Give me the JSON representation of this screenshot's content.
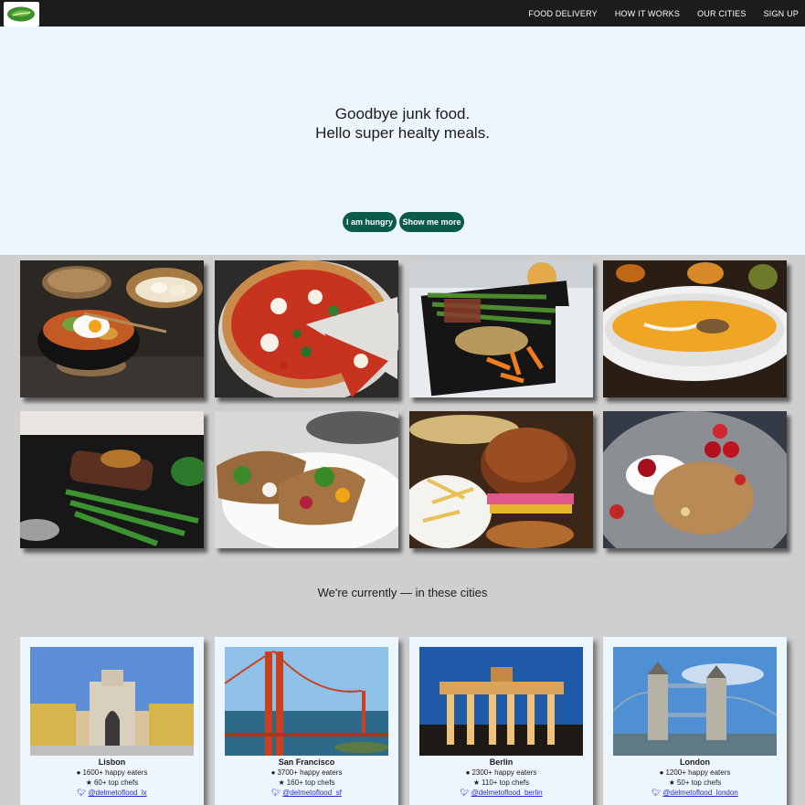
{
  "nav": {
    "logo_icon": "leaf-logo-icon",
    "links": [
      "Food delivery",
      "How it works",
      "Our cities",
      "Sign up"
    ]
  },
  "hero": {
    "title_line1": "Goodbye junk food.",
    "title_line2": "Hello super healty meals.",
    "primary_button": "I am hungry",
    "secondary_button": "Show me more",
    "button_color": "#0c5a4c"
  },
  "gallery": [
    "bibimbap-and-dumplings",
    "margherita-pizza",
    "asparagus-and-fries",
    "pumpkin-soup",
    "steak-with-green-beans",
    "stuffed-flatbread-wrap",
    "burger-and-fries",
    "granola-with-berries"
  ],
  "cities": {
    "heading": "We're currently — in these cities",
    "items": [
      {
        "name": "Lisbon",
        "eaters": "1600+ happy eaters",
        "chefs": "60+ top chefs",
        "twitter": "@delmetoflood_lx"
      },
      {
        "name": "San Francisco",
        "eaters": "3700+ happy eaters",
        "chefs": "160+ top chefs",
        "twitter": "@delmetoflood_sf"
      },
      {
        "name": "Berlin",
        "eaters": "2300+ happy eaters",
        "chefs": "110+ top chefs",
        "twitter": "@delmetoflood_berlin"
      },
      {
        "name": "London",
        "eaters": "1200+ happy eaters",
        "chefs": "50+ top chefs",
        "twitter": "@delmetoflood_london"
      }
    ]
  }
}
